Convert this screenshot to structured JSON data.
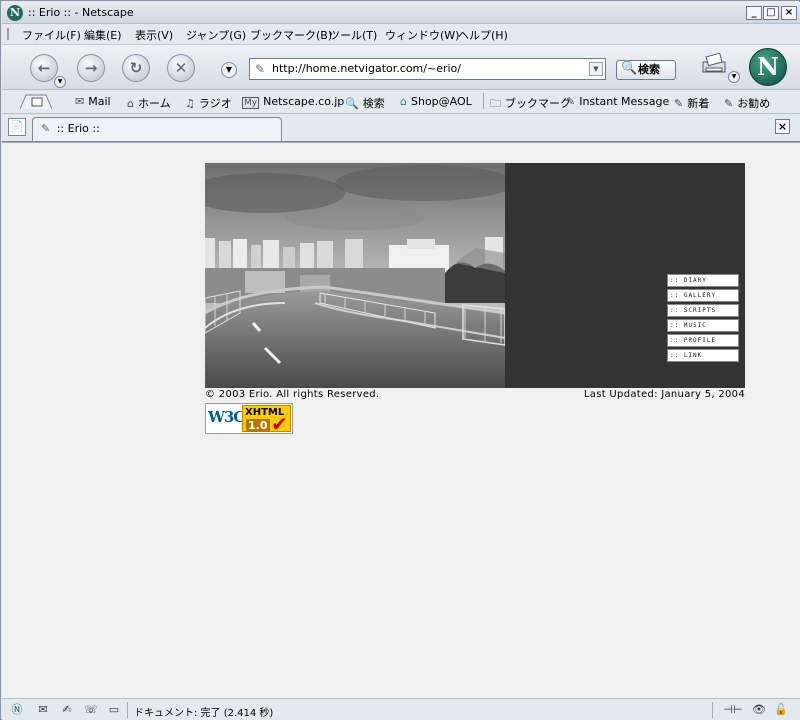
{
  "window": {
    "title": ":: Erio :: - Netscape"
  },
  "menu": [
    "ファイル(F)",
    "編集(E)",
    "表示(V)",
    "ジャンプ(G)",
    "ブックマーク(B)",
    "ツール(T)",
    "ウィンドウ(W)",
    "ヘルプ(H)"
  ],
  "nav": {
    "url": "http://home.netvigator.com/~erio/",
    "search_label": "検索"
  },
  "personal": {
    "items": [
      "Mail",
      "ホーム",
      "ラジオ",
      "Netscape.co.jp",
      "検索",
      "Shop@AOL",
      "ブックマーク",
      "Instant Message",
      "新着",
      "お勧め"
    ]
  },
  "tab": {
    "title": ":: Erio ::"
  },
  "page": {
    "nav_links": [
      ":: DIARY",
      ":: GALLERY",
      ":: SCRIPTS",
      ":: MUSIC",
      ":: PROFILE",
      ":: LINK"
    ],
    "copyright": "© 2003 Erio. All rights Reserved.",
    "updated": "Last Updated: January 5, 2004",
    "badge": {
      "w3c": "W3C",
      "xhtml": "XHTML",
      "version": "1.0"
    }
  },
  "status": {
    "text": "ドキュメント: 完了 (2.414 秒)"
  },
  "colors": {
    "banner_dark": "#333333",
    "badge_yellow": "#ffcc00",
    "netscape_green": "#1f6b5c"
  }
}
